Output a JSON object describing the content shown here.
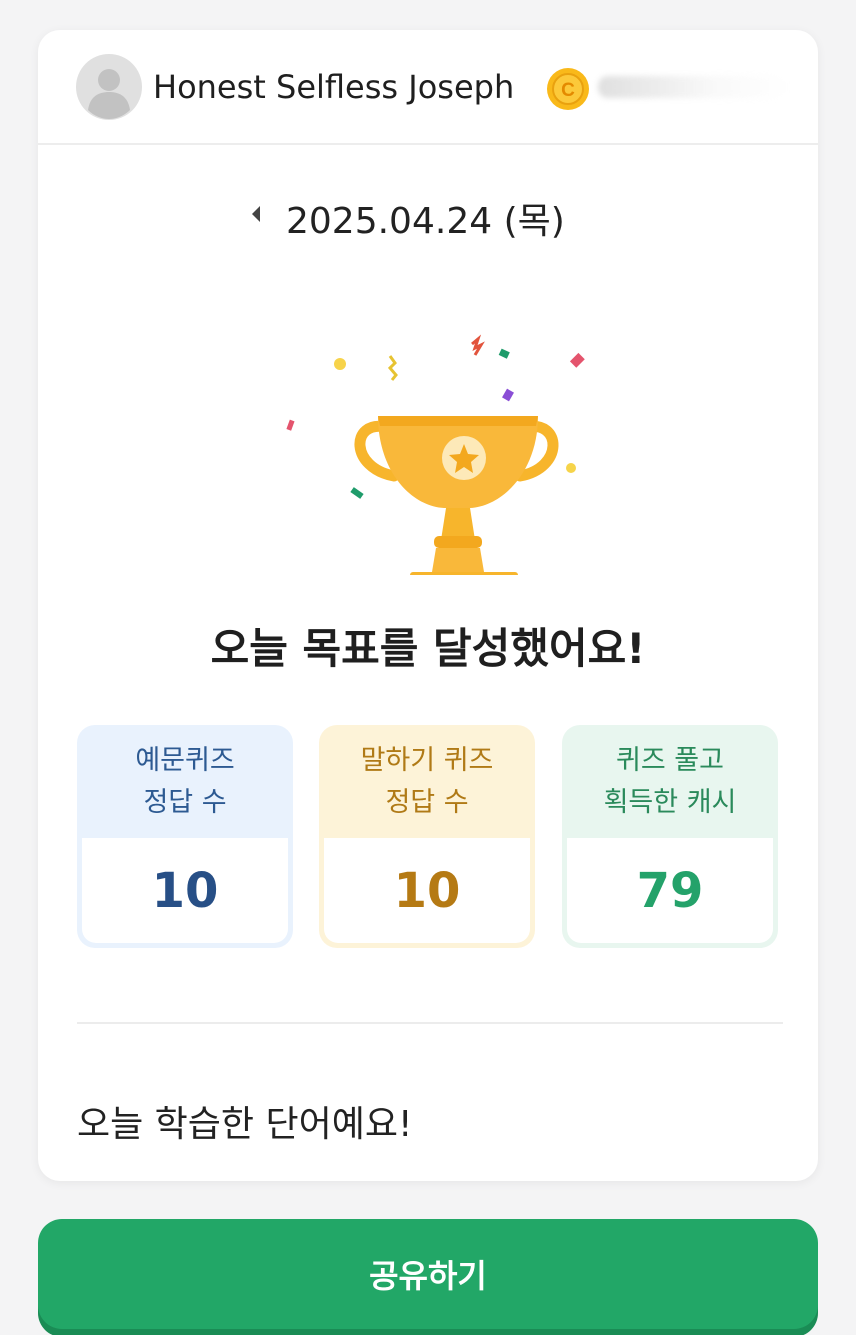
{
  "profile": {
    "username": "Honest Selfless Joseph",
    "coin_icon": "coin-icon",
    "avatar_icon": "default-avatar-icon"
  },
  "date_nav": {
    "date": "2025.04.24 (목)",
    "prev_icon": "caret-left-icon"
  },
  "headline": "오늘 목표를 달성했어요!",
  "stats": [
    {
      "label_line1": "예문퀴즈",
      "label_line2": "정답 수",
      "value": "10",
      "color": "#274f86"
    },
    {
      "label_line1": "말하기 퀴즈",
      "label_line2": "정답 수",
      "value": "10",
      "color": "#b57a14"
    },
    {
      "label_line1": "퀴즈 풀고",
      "label_line2": "획득한 캐시",
      "value": "79",
      "color": "#24a26a"
    }
  ],
  "words_title": "오늘 학습한 단어예요!",
  "share_button": "공유하기",
  "colors": {
    "accent_green": "#22a767",
    "trophy": "#f7b52c",
    "coin": "#f9b91a"
  }
}
